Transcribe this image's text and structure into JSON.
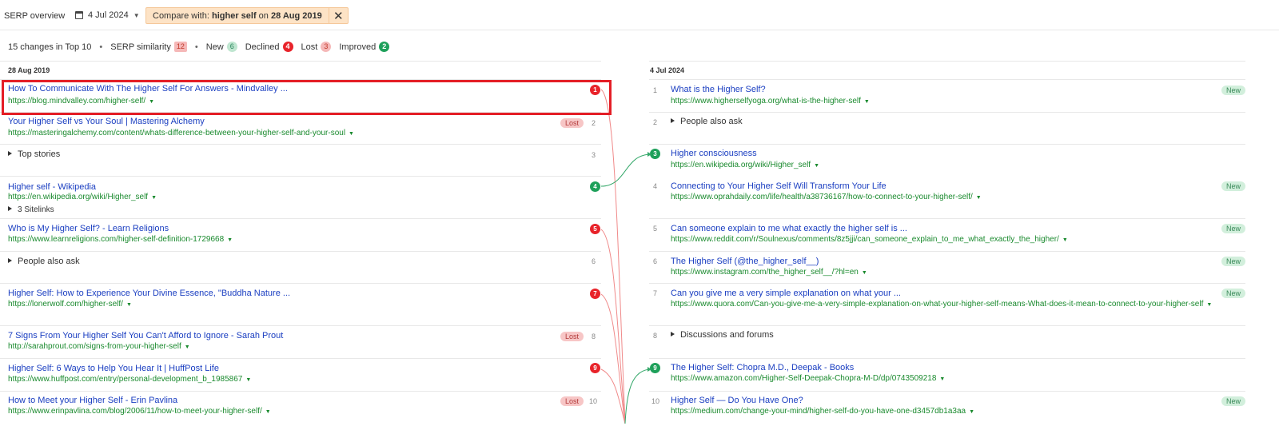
{
  "topbar": {
    "title": "SERP overview",
    "date": "4 Jul 2024",
    "compare_prefix": "Compare with:",
    "compare_keyword": "higher self",
    "compare_on": "on",
    "compare_date": "28 Aug 2019"
  },
  "summary": {
    "changes": "15 changes in Top 10",
    "similarity_label": "SERP similarity",
    "similarity_value": "12",
    "new_label": "New",
    "new_value": "6",
    "declined_label": "Declined",
    "declined_value": "4",
    "lost_label": "Lost",
    "lost_value": "3",
    "improved_label": "Improved",
    "improved_value": "2"
  },
  "left": {
    "heading": "28 Aug 2019",
    "rows": [
      {
        "pos": "1",
        "title": "How To Communicate With The Higher Self For Answers - Mindvalley ...",
        "url": "https://blog.mindvalley.com/higher-self/",
        "status": "declined"
      },
      {
        "pos": "2",
        "title": "Your Higher Self vs Your Soul | Mastering Alchemy",
        "url": "https://masteringalchemy.com/content/whats-difference-between-your-higher-self-and-your-soul",
        "tag": "Lost"
      },
      {
        "pos": "3",
        "feature": "Top stories"
      },
      {
        "pos": "4",
        "title": "Higher self - Wikipedia",
        "url": "https://en.wikipedia.org/wiki/Higher_self",
        "sitelinks": "3 Sitelinks",
        "status": "improved"
      },
      {
        "pos": "5",
        "title": "Who is My Higher Self? - Learn Religions",
        "url": "https://www.learnreligions.com/higher-self-definition-1729668",
        "status": "declined"
      },
      {
        "pos": "6",
        "feature": "People also ask"
      },
      {
        "pos": "7",
        "title": "Higher Self: How to Experience Your Divine Essence, \"Buddha Nature ...",
        "url": "https://lonerwolf.com/higher-self/",
        "status": "declined"
      },
      {
        "pos": "8",
        "title": "7 Signs From Your Higher Self You Can't Afford to Ignore - Sarah Prout",
        "url": "http://sarahprout.com/signs-from-your-higher-self",
        "tag": "Lost"
      },
      {
        "pos": "9",
        "title": "Higher Self: 6 Ways to Help You Hear It | HuffPost Life",
        "url": "https://www.huffpost.com/entry/personal-development_b_1985867",
        "status": "declined"
      },
      {
        "pos": "10",
        "title": "How to Meet your Higher Self - Erin Pavlina",
        "url": "https://www.erinpavlina.com/blog/2006/11/how-to-meet-your-higher-self/",
        "tag": "Lost"
      }
    ]
  },
  "right": {
    "heading": "4 Jul 2024",
    "rows": [
      {
        "pos": "1",
        "title": "What is the Higher Self?",
        "url": "https://www.higherselfyoga.org/what-is-the-higher-self",
        "tag": "New"
      },
      {
        "pos": "2",
        "feature": "People also ask"
      },
      {
        "pos": "3",
        "title": "Higher consciousness",
        "url": "https://en.wikipedia.org/wiki/Higher_self",
        "status": "improved"
      },
      {
        "pos": "4",
        "title": "Connecting to Your Higher Self Will Transform Your Life",
        "url": "https://www.oprahdaily.com/life/health/a38736167/how-to-connect-to-your-higher-self/",
        "tag": "New"
      },
      {
        "pos": "5",
        "title": "Can someone explain to me what exactly the higher self is ...",
        "url": "https://www.reddit.com/r/Soulnexus/comments/8z5jji/can_someone_explain_to_me_what_exactly_the_higher/",
        "tag": "New"
      },
      {
        "pos": "6",
        "title": "The Higher Self (@the_higher_self__)",
        "url": "https://www.instagram.com/the_higher_self__/?hl=en",
        "tag": "New"
      },
      {
        "pos": "7",
        "title": "Can you give me a very simple explanation on what your ...",
        "url": "https://www.quora.com/Can-you-give-me-a-very-simple-explanation-on-what-your-higher-self-means-What-does-it-mean-to-connect-to-your-higher-self",
        "tag": "New"
      },
      {
        "pos": "8",
        "feature": "Discussions and forums"
      },
      {
        "pos": "9",
        "title": "The Higher Self: Chopra M.D., Deepak - Books",
        "url": "https://www.amazon.com/Higher-Self-Deepak-Chopra-M-D/dp/0743509218",
        "status": "improved"
      },
      {
        "pos": "10",
        "title": "Higher Self — Do You Have One?",
        "url": "https://medium.com/change-your-mind/higher-self-do-you-have-one-d3457db1a3aa",
        "tag": "New"
      }
    ]
  },
  "colors": {
    "declined": "#e8232a",
    "improved": "#1ea05a",
    "link": "#1a3ec1",
    "url": "#1a8a2e",
    "highlight": "#e41e26"
  }
}
